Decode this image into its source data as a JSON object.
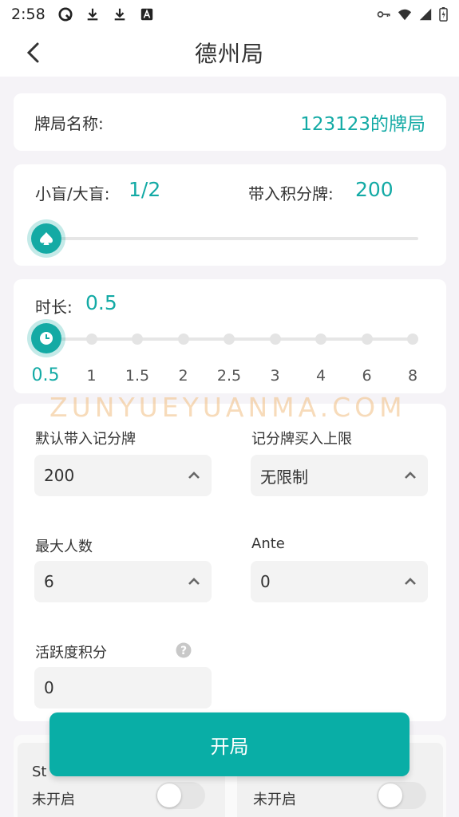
{
  "status_bar": {
    "time": "2:58",
    "left_icons": [
      "q-app-icon",
      "download-icon",
      "download-icon",
      "a-app-icon"
    ],
    "right_icons": [
      "key-icon",
      "wifi-icon",
      "signal-icon",
      "battery-icon"
    ]
  },
  "header": {
    "title": "德州局"
  },
  "game_name": {
    "label": "牌局名称:",
    "value": "123123的牌局"
  },
  "blinds": {
    "label": "小盲/大盲:",
    "value": "1/2",
    "buyin_label": "带入积分牌:",
    "buyin_value": "200",
    "slider_level": 0
  },
  "duration": {
    "label": "时长:",
    "value": "0.5",
    "ticks": [
      "0.5",
      "1",
      "1.5",
      "2",
      "2.5",
      "3",
      "4",
      "6",
      "8"
    ],
    "selected_index": 0
  },
  "watermark": "ZUNYUEYUANMA.COM",
  "settings": {
    "default_buyin_label": "默认带入记分牌",
    "default_buyin_value": "200",
    "buyin_limit_label": "记分牌买入上限",
    "buyin_limit_value": "无限制",
    "max_players_label": "最大人数",
    "max_players_value": "6",
    "ante_label": "Ante",
    "ante_value": "0",
    "activity_label": "活跃度积分",
    "activity_value": "0"
  },
  "start_button": {
    "label": "开局"
  },
  "toggles": {
    "left_title_partial": "St",
    "left_status": "未开启",
    "right_status": "未开启"
  },
  "colors": {
    "accent": "#13aaa5",
    "button": "#09aea6"
  }
}
